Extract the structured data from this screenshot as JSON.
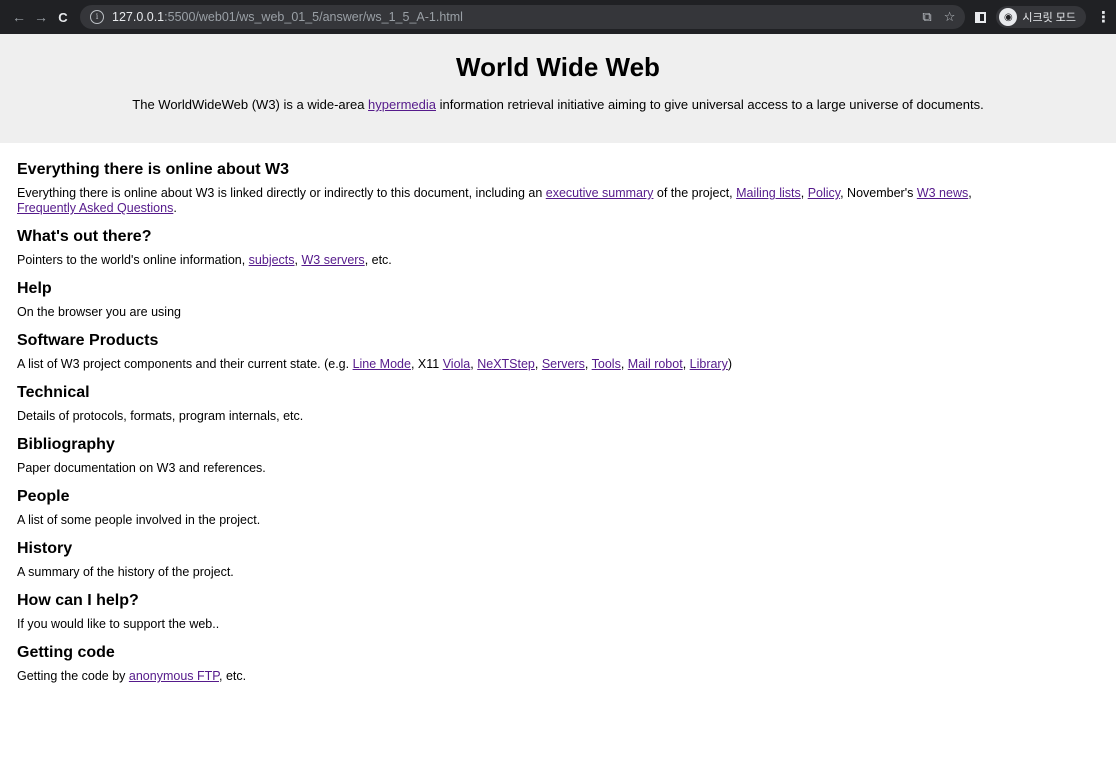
{
  "browser": {
    "back_icon": "←",
    "forward_icon": "→",
    "reload_icon": "C",
    "url_host": "127.0.0.1",
    "url_path": ":5500/web01/ws_web_01_5/answer/ws_1_5_A-1.html",
    "profile_label": "시크릿 모드"
  },
  "header": {
    "title": "World Wide Web",
    "intro_before": "The WorldWideWeb (W3) is a wide-area ",
    "intro_link": "hypermedia",
    "intro_after": " information retrieval initiative aiming to give universal access to a large universe of documents."
  },
  "sections": [
    {
      "title": "Everything there is online about W3",
      "t0": "Everything there is online about W3 is linked directly or indirectly to this document, including an ",
      "l0": "executive summary",
      "t1": " of the project, ",
      "l1": "Mailing lists",
      "t2": ", ",
      "l2": "Policy",
      "t3": ", November's ",
      "l3": "W3 news",
      "t4": ",",
      "l4": "Frequently Asked Questions",
      "t5": "."
    },
    {
      "title": "What's out there?",
      "t0": "Pointers to the world's online information, ",
      "l0": "subjects",
      "t1": ", ",
      "l1": "W3 servers",
      "t2": ", etc."
    },
    {
      "title": "Help",
      "text": "On the browser you are using"
    },
    {
      "title": "Software Products",
      "t0": "A list of W3 project components and their current state. (e.g. ",
      "l0": "Line Mode",
      "t1": ", X11 ",
      "l1": "Viola",
      "t2": ", ",
      "l2": "NeXTStep",
      "t3": ", ",
      "l3": "Servers",
      "t4": ", ",
      "l4": "Tools",
      "t5": ", ",
      "l5": "Mail robot",
      "t6": ", ",
      "l6": "Library",
      "t7": ")"
    },
    {
      "title": "Technical",
      "text": "Details of protocols, formats, program internals, etc."
    },
    {
      "title": "Bibliography",
      "text": "Paper documentation on W3 and references."
    },
    {
      "title": "People",
      "text": "A list of some people involved in the project."
    },
    {
      "title": "History",
      "text": "A summary of the history of the project."
    },
    {
      "title": "How can I help?",
      "text": "If you would like to support the web.."
    },
    {
      "title": "Getting code",
      "t0": "Getting the code by ",
      "l0": "anonymous FTP",
      "t1": ", etc."
    }
  ]
}
